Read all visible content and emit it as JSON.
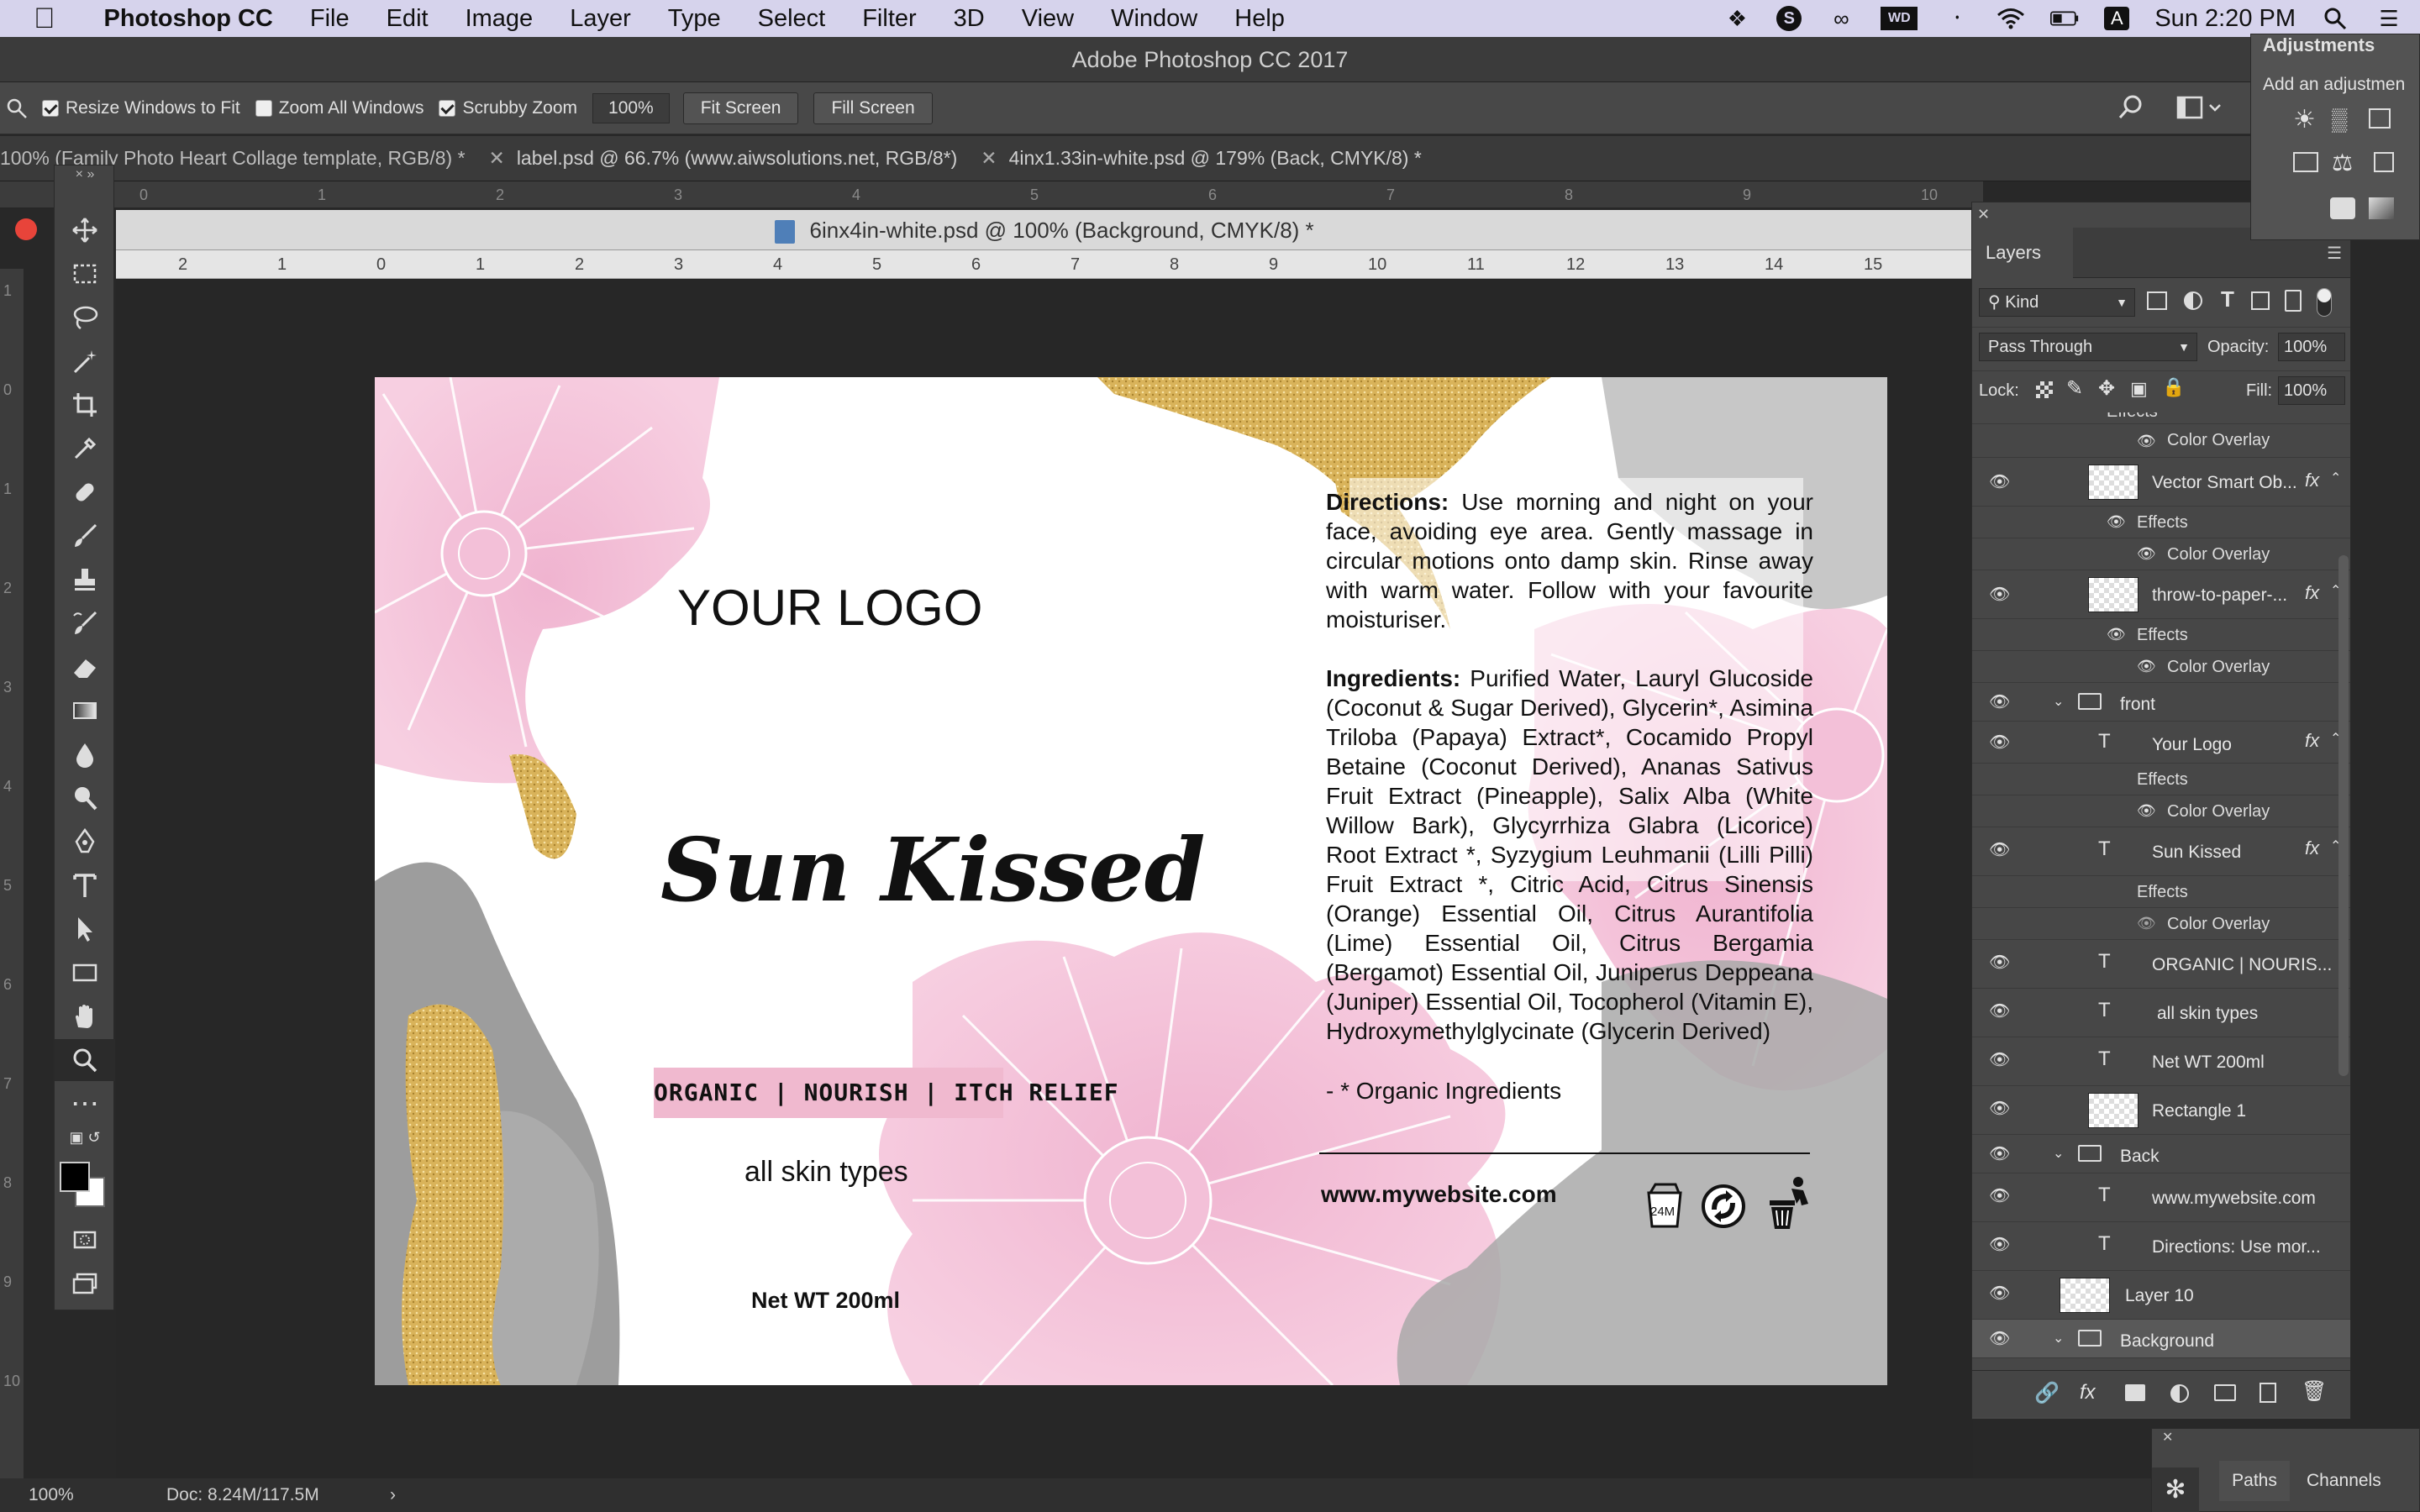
{
  "menubar": {
    "app": "Photoshop CC",
    "items": [
      "File",
      "Edit",
      "Image",
      "Layer",
      "Type",
      "Select",
      "Filter",
      "3D",
      "View",
      "Window",
      "Help"
    ],
    "clock": "Sun 2:20 PM",
    "badge_letter": "A"
  },
  "window_title": "Adobe Photoshop CC 2017",
  "options": {
    "resize_windows": "Resize Windows to Fit",
    "zoom_all": "Zoom All Windows",
    "scrubby": "Scrubby Zoom",
    "zoom_value": "100%",
    "fit_screen": "Fit Screen",
    "fill_screen": "Fill Screen"
  },
  "tabs": [
    {
      "label": "100% (Family Photo Heart Collage template, RGB/8) *"
    },
    {
      "label": "label.psd @ 66.7% (www.aiwsolutions.net, RGB/8*)"
    },
    {
      "label": "4inx1.33in-white.psd @ 179% (Back, CMYK/8) *"
    }
  ],
  "document_title": "6inx4in-white.psd @ 100% (Background, CMYK/8) *",
  "ruler_top_marks": [
    "0",
    "1",
    "2",
    "3",
    "4",
    "5",
    "6",
    "7",
    "8",
    "9",
    "10"
  ],
  "ruler_doc_marks": [
    "2",
    "1",
    "0",
    "1",
    "2",
    "3",
    "4",
    "5",
    "6",
    "7",
    "8",
    "9",
    "10",
    "11",
    "12",
    "13",
    "14",
    "15"
  ],
  "vruler_marks": [
    "1",
    "0",
    "1",
    "2",
    "3",
    "4",
    "5",
    "6",
    "7",
    "8",
    "9",
    "10"
  ],
  "label": {
    "logo": "YOUR LOGO",
    "product": "Sun Kissed",
    "tagline": "ORGANIC | NOURISH | ITCH RELIEF",
    "skin": "all skin types",
    "net": "Net WT 200ml",
    "directions_head": "Directions:",
    "directions": "Use morning and night on your face, avoiding eye area. Gently massage in circular motions onto damp skin. Rinse away with warm water. Follow with your favourite moisturiser.",
    "ingredients_head": "Ingredients:",
    "ingredients": "Purified Water, Lauryl Glucoside (Coconut & Sugar Derived), Glycerin*, Asimina Triloba (Papaya) Extract*, Cocamido Propyl Betaine (Coconut Derived), Ananas Sativus Fruit Extract (Pineapple), Salix Alba (White Willow Bark), Glycyrrhiza Glabra (Licorice) Root Extract *, Syzygium Leuhmanii (Lilli Pilli) Fruit Extract *, Citric Acid, Citrus Sinensis (Orange) Essential Oil, Citrus Aurantifolia (Lime) Essential Oil, Citrus Bergamia (Bergamot) Essential Oil, Juniperus Deppeana (Juniper) Essential Oil, Tocopherol (Vitamin E), Hydroxymethylglycinate (Glycerin Derived)",
    "organic_note": "- * Organic Ingredients",
    "website": "www.mywebsite.com",
    "pao": "24M"
  },
  "status": {
    "zoom": "100%",
    "doc": "Doc: 8.24M/117.5M"
  },
  "layers": {
    "tab": "Layers",
    "kind": "Kind",
    "blend": "Pass Through",
    "opacity_label": "Opacity:",
    "opacity": "100%",
    "lock_label": "Lock:",
    "fill_label": "Fill:",
    "fill": "100%",
    "rows": {
      "effects_top": "Effects",
      "color_overlay_1": "Color Overlay",
      "vector_smart": "Vector Smart Ob...",
      "effects_1": "Effects",
      "color_overlay_2": "Color Overlay",
      "throw": "throw-to-paper-...",
      "effects_2": "Effects",
      "color_overlay_3": "Color Overlay",
      "front": "front",
      "your_logo": "Your Logo",
      "effects_3": "Effects",
      "color_overlay_4": "Color Overlay",
      "sun_kissed": "Sun Kissed",
      "effects_4": "Effects",
      "color_overlay_5": "Color Overlay",
      "organic": "ORGANIC | NOURIS...",
      "skin": "all skin types",
      "net": "Net WT 200ml",
      "rect": "Rectangle 1",
      "back": "Back",
      "website": "www.mywebsite.com",
      "directions": "Directions: Use mor...",
      "layer10": "Layer 10",
      "background": "Background"
    },
    "fx": "fx"
  },
  "adjustments": {
    "title": "Adjustments",
    "hint": "Add an adjustmen"
  },
  "bottom_tabs": {
    "paths": "Paths",
    "channels": "Channels"
  }
}
